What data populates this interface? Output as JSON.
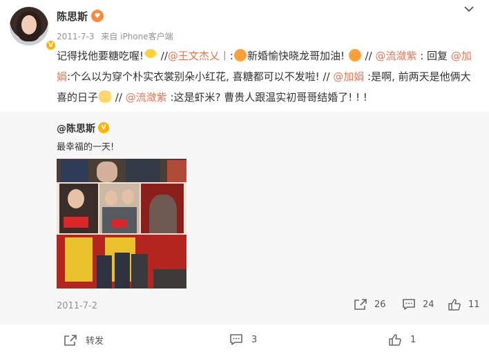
{
  "user": {
    "name": "陈思斯",
    "verified_icon": "verified-v-icon",
    "emoji_icon": "love-emoji-icon"
  },
  "post": {
    "date": "2011-7-3",
    "source": "来自 iPhone客户端",
    "segments": [
      {
        "t": "记得找他要糖吃喔!"
      },
      {
        "emoji": "grin"
      },
      {
        "t": " //"
      },
      {
        "link": "@王文杰乂丨"
      },
      {
        "t": ":"
      },
      {
        "emoji": "laugh"
      },
      {
        "t": "新婚愉快晓龙哥加油! "
      },
      {
        "emoji": "laugh"
      },
      {
        "t": " // "
      },
      {
        "link": "@流潋紫"
      },
      {
        "t": " : 回复 "
      },
      {
        "link": "@加娟"
      },
      {
        "t": ":个么以为穿个朴实衣裳别朵小红花, 喜糖都可以不发啦! // "
      },
      {
        "link": "@加娟"
      },
      {
        "t": " :是啊, 前两天是他俩大喜的日子"
      },
      {
        "emoji": "hide"
      },
      {
        "t": " // "
      },
      {
        "link": "@流潋紫"
      },
      {
        "t": " :这是虾米? 曹贵人跟温实初哥哥结婚了! ! !"
      }
    ]
  },
  "retweet": {
    "user": "@陈思斯",
    "text": "最幸福的一天!",
    "date": "2011-7-2",
    "share_count": "26",
    "comment_count": "24",
    "like_count": "11"
  },
  "actions": {
    "repost_label": "转发",
    "comment_count": "3",
    "like_count": "1"
  },
  "colors": {
    "link": "#eb7350",
    "muted": "#939393",
    "retweet_bg": "#f7f7f7",
    "badge": "#ffb400"
  }
}
